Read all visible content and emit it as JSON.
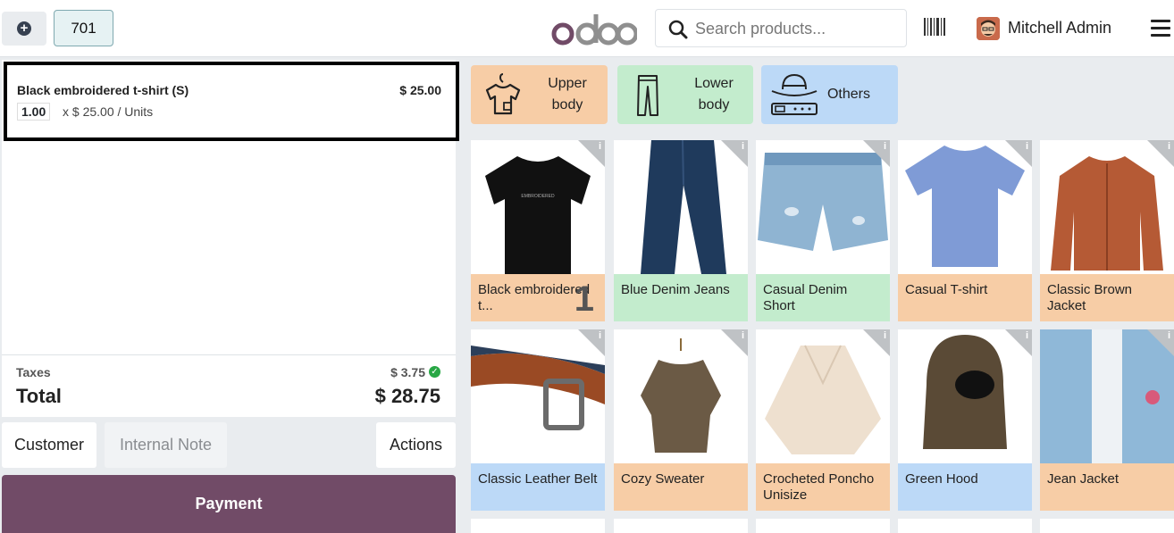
{
  "header": {
    "order_number": "701",
    "logo": "odoo",
    "search_placeholder": "Search products...",
    "user_name": "Mitchell Admin"
  },
  "order": {
    "lines": [
      {
        "name": "Black embroidered t-shirt (S)",
        "price": "$ 25.00",
        "qty": "1.00",
        "unit_text": "x $ 25.00 / Units"
      }
    ],
    "taxes_label": "Taxes",
    "taxes_value": "$ 3.75",
    "total_label": "Total",
    "total_value": "$ 28.75"
  },
  "buttons": {
    "customer": "Customer",
    "internal_note": "Internal Note",
    "actions": "Actions",
    "payment": "Payment"
  },
  "categories": [
    {
      "line1": "Upper",
      "line2": "body",
      "icon": "tshirt-icon",
      "color": "#f7cda6"
    },
    {
      "line1": "Lower",
      "line2": "body",
      "icon": "pants-icon",
      "color": "#c3eccd"
    },
    {
      "line1": "Others",
      "line2": "",
      "icon": "hat-belt-icon",
      "color": "#bcd9f7"
    }
  ],
  "products": [
    {
      "name": "Black embroidered t...",
      "count": "1",
      "category": "upper"
    },
    {
      "name": "Blue Denim Jeans",
      "category": "lower"
    },
    {
      "name": "Casual Denim Short",
      "category": "lower"
    },
    {
      "name": "Casual T-shirt",
      "category": "upper"
    },
    {
      "name": "Classic Brown Jacket",
      "category": "upper"
    },
    {
      "name": "Classic Leather Belt",
      "category": "other"
    },
    {
      "name": "Cozy Sweater",
      "category": "upper"
    },
    {
      "name": "Crocheted Poncho Unisize",
      "category": "upper"
    },
    {
      "name": "Green Hood",
      "category": "other"
    },
    {
      "name": "Jean Jacket",
      "category": "upper"
    }
  ],
  "colors": {
    "brand": "#714b67",
    "upper": "#f7cda6",
    "lower": "#c3eccd",
    "other": "#bcd9f7"
  }
}
